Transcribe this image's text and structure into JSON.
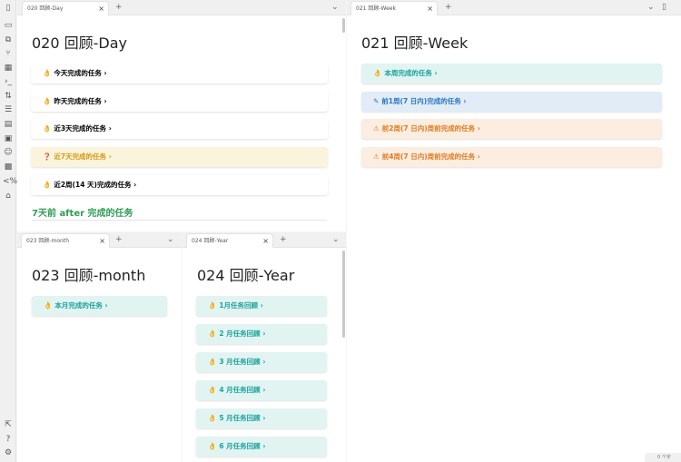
{
  "ribbon": {
    "icons": [
      "sidebar-toggle-icon",
      "file-explorer-icon",
      "copy-icon",
      "graph-icon",
      "calendar-icon",
      "terminal-icon",
      "sort-icon",
      "database-icon",
      "layout-icon",
      "canvas-icon",
      "smile-icon",
      "image-icon",
      "percent-code-icon",
      "home-icon"
    ],
    "bottom_icons": [
      "export-icon",
      "help-icon",
      "settings-icon"
    ]
  },
  "pane_day": {
    "tab_label": "020 回顾-Day",
    "title": "020 回顾-Day",
    "cards": [
      {
        "icon": "👌",
        "label": "今天完成的任务",
        "style": "teal"
      },
      {
        "icon": "👌",
        "label": "昨天完成的任务",
        "style": "teal"
      },
      {
        "icon": "👌",
        "label": "近3天完成的任务",
        "style": "teal"
      },
      {
        "icon": "❓",
        "label": "近7天完成的任务",
        "style": "yellow"
      },
      {
        "icon": "👌",
        "label": "近2周(14 天)完成的任务",
        "style": "teal"
      }
    ],
    "section_heading": "7天前 after 完成的任务"
  },
  "pane_week": {
    "tab_label": "021 回顾-Week",
    "title": "021 回顾-Week",
    "cards": [
      {
        "icon": "👌",
        "label": "本周完成的任务",
        "style": "teal"
      },
      {
        "icon": "✎",
        "label": "前1周(7 日内)完成的任务",
        "style": "blue"
      },
      {
        "icon": "⚠",
        "label": "前2周(7 日内)周前完成的任务",
        "style": "orange"
      },
      {
        "icon": "⚠",
        "label": "前4周(7 日内)周前完成的任务",
        "style": "orange"
      }
    ]
  },
  "pane_month": {
    "tab_label": "023 回顾-month",
    "title": "023 回顾-month",
    "cards": [
      {
        "icon": "👌",
        "label": "本月完成的任务",
        "style": "teal"
      }
    ]
  },
  "pane_year": {
    "tab_label": "024 回顾-Year",
    "title": "024 回顾-Year",
    "cards": [
      {
        "icon": "👌",
        "label": "1月任务回顾",
        "style": "teal"
      },
      {
        "icon": "👌",
        "label": "2 月任务回顾",
        "style": "teal"
      },
      {
        "icon": "👌",
        "label": "3 月任务回顾",
        "style": "teal"
      },
      {
        "icon": "👌",
        "label": "4 月任务回顾",
        "style": "teal"
      },
      {
        "icon": "👌",
        "label": "5 月任务回顾",
        "style": "teal"
      },
      {
        "icon": "👌",
        "label": "6 月任务回顾",
        "style": "teal"
      }
    ]
  },
  "tab_controls": {
    "new_tab": "+",
    "close": "×",
    "dropdown": "⌄",
    "chevron": "›"
  },
  "status_bar": {
    "text": "0 个字"
  }
}
